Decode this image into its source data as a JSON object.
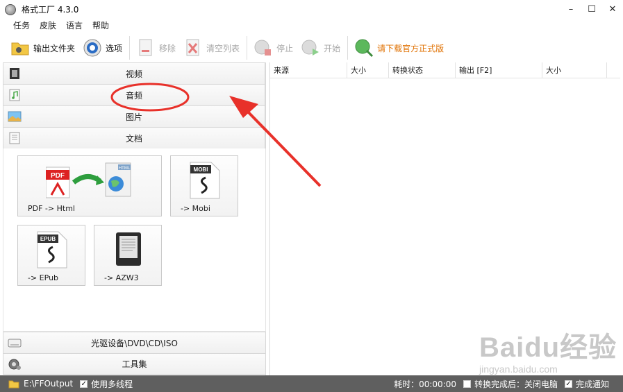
{
  "window": {
    "title": "格式工厂 4.3.0",
    "controls": [
      "minimize-icon",
      "maximize-icon",
      "close-icon"
    ]
  },
  "menu": [
    "任务",
    "皮肤",
    "语言",
    "帮助"
  ],
  "toolbar": {
    "output_folder": "输出文件夹",
    "options": "选项",
    "remove": "移除",
    "clear_list": "清空列表",
    "stop": "停止",
    "start": "开始",
    "download_official": "请下载官方正式版"
  },
  "categories": {
    "video": "视频",
    "audio": "音频",
    "image": "图片",
    "document": "文档",
    "rom": "光驱设备\\DVD\\CD\\ISO",
    "tools": "工具集"
  },
  "tiles": {
    "pdf_html": {
      "label": "PDF -> Html",
      "badge1": "PDF",
      "badge2": "HTML"
    },
    "mobi": {
      "label": "-> Mobi",
      "badge": "MOBI"
    },
    "epub": {
      "label": "-> EPub",
      "badge": "EPUB"
    },
    "azw3": {
      "label": "-> AZW3"
    }
  },
  "list": {
    "columns": [
      "来源",
      "大小",
      "转换状态",
      "输出 [F2]",
      "大小"
    ]
  },
  "status": {
    "output_path": "E:\\FFOutput",
    "multithread": "使用多线程",
    "elapsed_label": "耗时：00:00:00",
    "after_convert": "转换完成后：关闭电脑",
    "notify": "完成通知"
  },
  "watermark": {
    "brand": "Baidu经验",
    "url": "jingyan.baidu.com"
  },
  "colors": {
    "annotation": "#e8312a",
    "promo": "#e07000",
    "statusbar": "#5f5f5f"
  }
}
